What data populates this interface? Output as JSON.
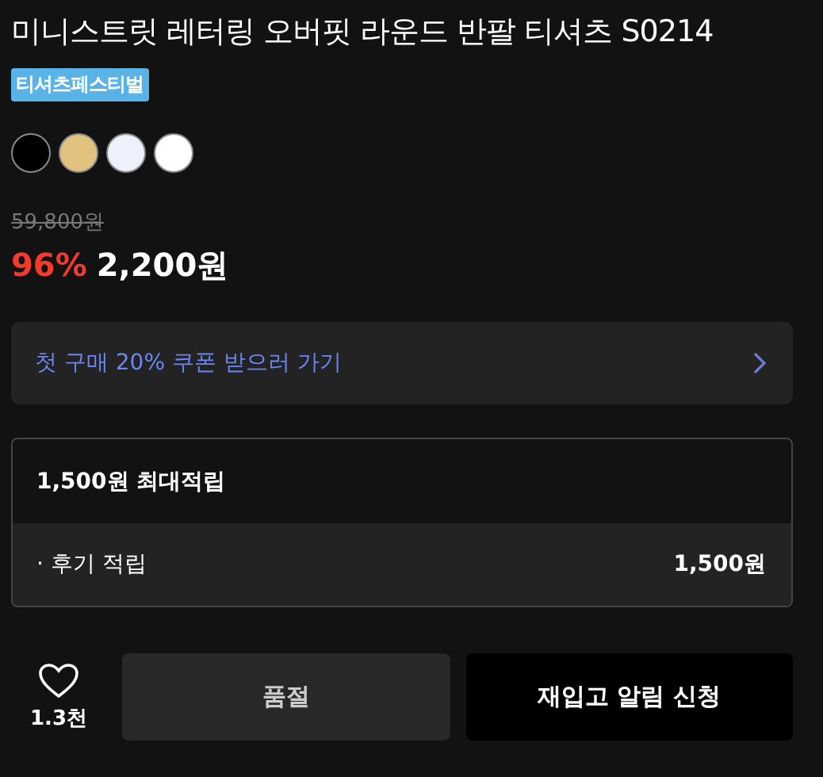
{
  "title": "미니스트릿 레터링 오버핏 라운드 반팔 티셔츠 S0214",
  "badge": "티셔츠페스티벌",
  "swatches": [
    {
      "color": "#000000"
    },
    {
      "color": "#e2c27f"
    },
    {
      "color": "#eef0fc"
    },
    {
      "color": "#ffffff"
    }
  ],
  "original_price": "59,800원",
  "discount": "96%",
  "price": "2,200원",
  "coupon": {
    "label": "첫 구매 20% 쿠폰 받으러 가기"
  },
  "points": {
    "title": "1,500원 최대적립",
    "rows": [
      {
        "label": "· 후기 적립",
        "value": "1,500원"
      }
    ]
  },
  "like_count": "1.3천",
  "buttons": [
    {
      "label": "품절",
      "kind": "soldout"
    },
    {
      "label": "재입고 알림 신청",
      "kind": "primary"
    }
  ]
}
